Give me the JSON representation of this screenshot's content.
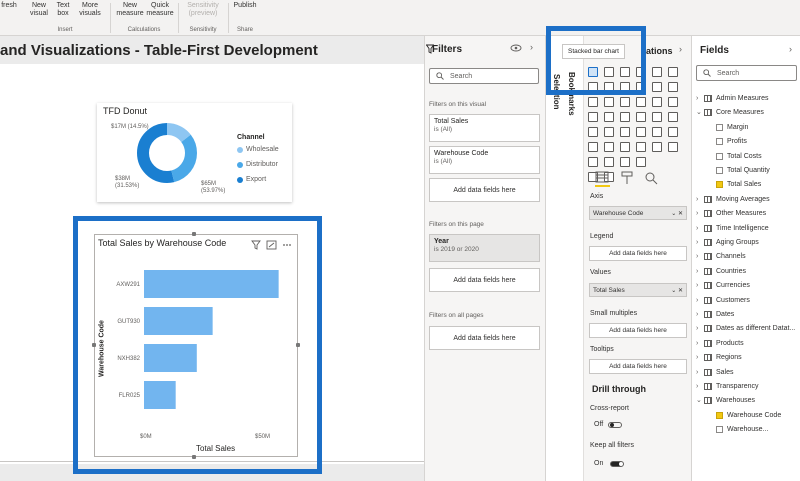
{
  "ribbon": {
    "refresh": "fresh",
    "new_visual": "New visual",
    "text_box": "Text box",
    "more_visuals": "More visuals",
    "new_measure": "New measure",
    "quick_measure": "Quick measure",
    "sensitivity": "Sensitivity (preview)",
    "publish": "Publish",
    "groups": [
      "Insert",
      "Calculations",
      "Sensitivity",
      "Share"
    ]
  },
  "page_title": "and Visualizations - Table-First Development",
  "donut": {
    "title": "TFD Donut",
    "legend_title": "Channel",
    "data_labels": [
      "$17M (14.5%)",
      "$38M (31.53%)",
      "$65M (53.97%)"
    ],
    "colors": {
      "wholesale": "#8ec6f2",
      "distributor": "#4aa8e8",
      "export": "#1a7fd1"
    }
  },
  "chart_data": {
    "type": "bar",
    "title": "Total Sales by Warehouse Code",
    "xlabel": "Total Sales",
    "ylabel": "Warehouse Code",
    "categories": [
      "AXW291",
      "GUT930",
      "NXH382",
      "FLR025"
    ],
    "values": [
      51,
      26,
      20,
      12
    ],
    "xlim": [
      0,
      50
    ],
    "xticks": [
      "$0M",
      "$50M"
    ],
    "color": "#72b5ef"
  },
  "filters": {
    "title": "Filters",
    "search_placeholder": "Search",
    "on_this_visual": "Filters on this visual",
    "visual_filters": [
      {
        "name": "Total Sales",
        "state": "is (All)"
      },
      {
        "name": "Warehouse Code",
        "state": "is (All)"
      }
    ],
    "add_label": "Add data fields here",
    "on_this_page": "Filters on this page",
    "page_filter": {
      "name": "Year",
      "state": "is 2019 or 2020"
    },
    "on_all_pages": "Filters on all pages"
  },
  "vtabs": {
    "bookmarks": "Bookmarks",
    "selection": "Selection"
  },
  "viz": {
    "title": "ations",
    "tooltip": "Stacked bar chart",
    "axis": "Axis",
    "axis_field": "Warehouse Code",
    "legend": "Legend",
    "values": "Values",
    "values_field": "Total Sales",
    "small_multiples": "Small multiples",
    "tooltips": "Tooltips",
    "add_label": "Add data fields here",
    "drill_through": "Drill through",
    "cross_report": "Cross-report",
    "off": "Off",
    "keep_all_filters": "Keep all filters",
    "on": "On"
  },
  "fields": {
    "title": "Fields",
    "search_placeholder": "Search",
    "items": [
      {
        "label": "Admin Measures",
        "type": "table",
        "expanded": false
      },
      {
        "label": "Core Measures",
        "type": "table",
        "expanded": true
      },
      {
        "label": "Margin",
        "type": "field",
        "checked": false
      },
      {
        "label": "Profits",
        "type": "field",
        "checked": false
      },
      {
        "label": "Total Costs",
        "type": "field",
        "checked": false
      },
      {
        "label": "Total Quantity",
        "type": "field",
        "checked": false
      },
      {
        "label": "Total Sales",
        "type": "field",
        "checked": true
      },
      {
        "label": "Moving Averages",
        "type": "table",
        "expanded": false
      },
      {
        "label": "Other Measures",
        "type": "table",
        "expanded": false
      },
      {
        "label": "Time Intelligence",
        "type": "table",
        "expanded": false
      },
      {
        "label": "Aging Groups",
        "type": "table",
        "expanded": false
      },
      {
        "label": "Channels",
        "type": "table",
        "expanded": false
      },
      {
        "label": "Countries",
        "type": "table",
        "expanded": false
      },
      {
        "label": "Currencies",
        "type": "table",
        "expanded": false
      },
      {
        "label": "Customers",
        "type": "table",
        "expanded": false
      },
      {
        "label": "Dates",
        "type": "table",
        "expanded": false
      },
      {
        "label": "Dates as different Datat...",
        "type": "table",
        "expanded": false
      },
      {
        "label": "Products",
        "type": "table",
        "expanded": false
      },
      {
        "label": "Regions",
        "type": "table",
        "expanded": false
      },
      {
        "label": "Sales",
        "type": "table",
        "expanded": false
      },
      {
        "label": "Transparency",
        "type": "table",
        "expanded": false
      },
      {
        "label": "Warehouses",
        "type": "table",
        "expanded": true
      },
      {
        "label": "Warehouse Code",
        "type": "field",
        "checked": true
      },
      {
        "label": "Warehouse...",
        "type": "field",
        "checked": false
      }
    ]
  }
}
